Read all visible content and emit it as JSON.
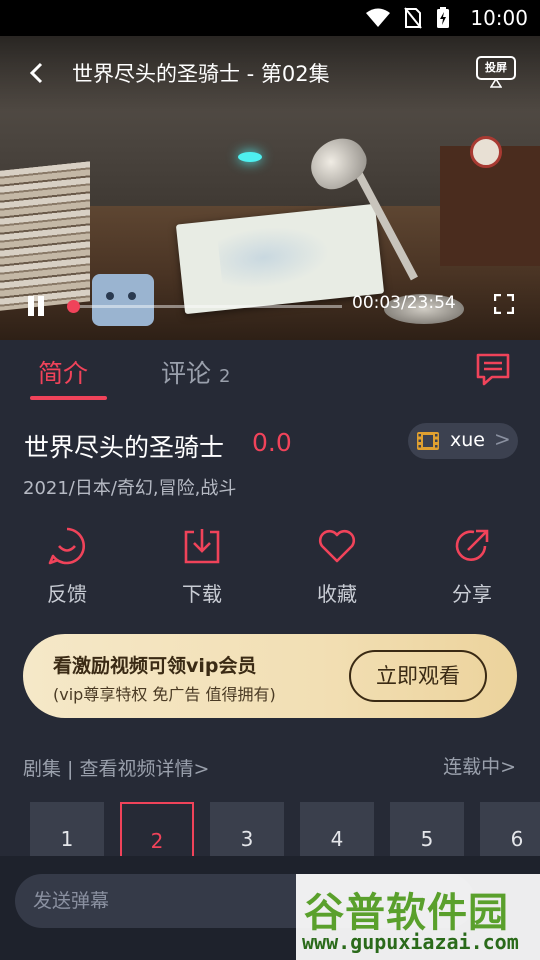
{
  "status_bar": {
    "time": "10:00"
  },
  "player": {
    "title": "世界尽头的圣骑士 - 第02集",
    "cast_label": "投屏",
    "time_display": "00:03/23:54",
    "progress_fraction": 0.002
  },
  "tabs": [
    {
      "label": "简介",
      "active": true
    },
    {
      "label": "评论",
      "count": "2",
      "active": false
    }
  ],
  "show": {
    "title": "世界尽头的圣骑士",
    "score": "0.0",
    "meta": "2021/日本/奇幻,冒险,战斗",
    "uploader": "xue"
  },
  "actions": [
    {
      "label": "反馈",
      "icon": "smile-feedback-icon"
    },
    {
      "label": "下载",
      "icon": "download-icon"
    },
    {
      "label": "收藏",
      "icon": "heart-icon"
    },
    {
      "label": "分享",
      "icon": "share-icon"
    }
  ],
  "vip_banner": {
    "title": "看激励视频可领vip会员",
    "subtitle": "(vip尊享特权 免广告 值得拥有)",
    "button": "立即观看"
  },
  "episodes_header": {
    "left": "剧集 | 查看视频详情>",
    "right": "连载中>"
  },
  "episodes": [
    "1",
    "2",
    "3",
    "4",
    "5",
    "6"
  ],
  "selected_episode": "2",
  "danmaku": {
    "placeholder": "发送弹幕"
  },
  "watermark": {
    "main": "谷普软件园",
    "url": "www.gupuxiazai.com"
  },
  "colors": {
    "accent": "#f0435a",
    "panel": "#262a36",
    "vip_gold": "#f2dfb4"
  }
}
